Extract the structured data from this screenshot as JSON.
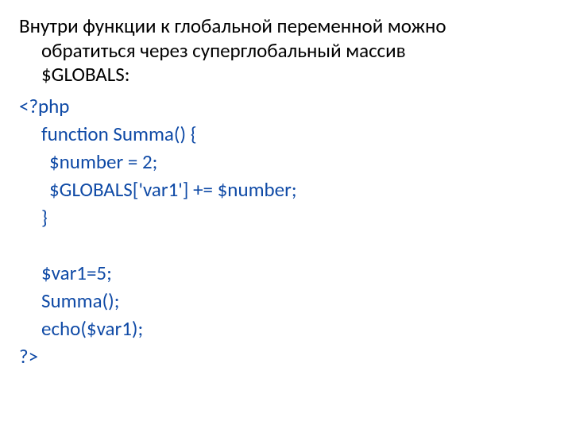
{
  "intro": {
    "line1": "Внутри функции к глобальной переменной можно",
    "line2": "обратиться через суперглобальный массив",
    "line3": "$GLOBALS:"
  },
  "code": {
    "open": "<?php",
    "l1": "function Summa() {",
    "l2": "$number = 2;",
    "l3": "$GLOBALS['var1'] += $number;",
    "l4": "}",
    "l5": "$var1=5;",
    "l6": "Summa();",
    "l7": "echo($var1);",
    "close": "?>"
  }
}
